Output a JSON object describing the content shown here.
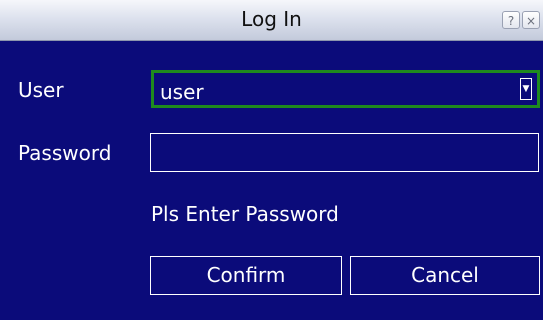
{
  "dialog": {
    "title": "Log In",
    "help_button": "?",
    "close_button": "×",
    "user_label": "User",
    "user_value": "user",
    "password_label": "Password",
    "password_value": "",
    "prompt": "Pls Enter Password",
    "confirm_label": "Confirm",
    "cancel_label": "Cancel"
  },
  "colors": {
    "background": "#0b0b7a",
    "focus_border": "#1f8a1f",
    "text": "#ffffff"
  }
}
